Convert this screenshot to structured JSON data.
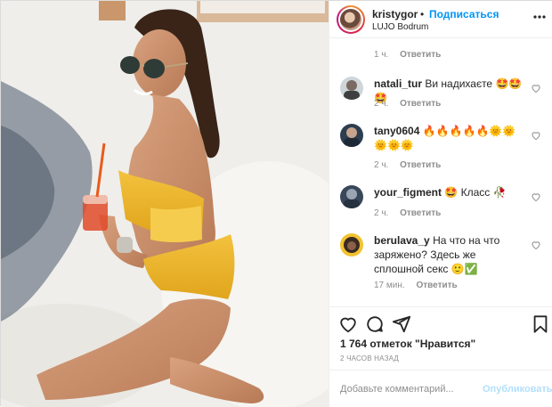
{
  "post": {
    "username": "kristygor",
    "follow_label": "Подписаться",
    "separator": "•",
    "location": "LUJO Bodrum",
    "more_icon": "more-horizontal-icon"
  },
  "first_meta": {
    "time": "1 ч.",
    "reply": "Ответить"
  },
  "comments": [
    {
      "username": "natali_tur",
      "text": "Ви надихаєте 🤩🤩🤩",
      "time": "2 ч.",
      "reply": "Ответить"
    },
    {
      "username": "tany0604",
      "text": "🔥🔥🔥🔥🔥🌞🌞🌞🌞🌞",
      "time": "2 ч.",
      "reply": "Ответить"
    },
    {
      "username": "your_figment",
      "text": "🤩 Класс 🥀",
      "time": "2 ч.",
      "reply": "Ответить"
    },
    {
      "username": "berulava_y",
      "text": "На что на что заряжено? Здесь же сплошной секс 🙂✅",
      "time": "17 мин.",
      "reply": "Ответить"
    }
  ],
  "actions": {
    "like_icon": "heart-icon",
    "comment_icon": "comment-icon",
    "share_icon": "paper-plane-icon",
    "save_icon": "bookmark-icon"
  },
  "likes_text": "1 764 отметок \"Нравится\"",
  "posted_text": "2 ЧАСОВ НАЗАД",
  "add_comment": {
    "placeholder": "Добавьте комментарий...",
    "publish_label": "Опубликовать"
  },
  "colors": {
    "link_blue": "#0095f6",
    "publish_disabled": "#b2dffc",
    "muted_text": "#8e8e8e",
    "divider": "#efefef"
  }
}
